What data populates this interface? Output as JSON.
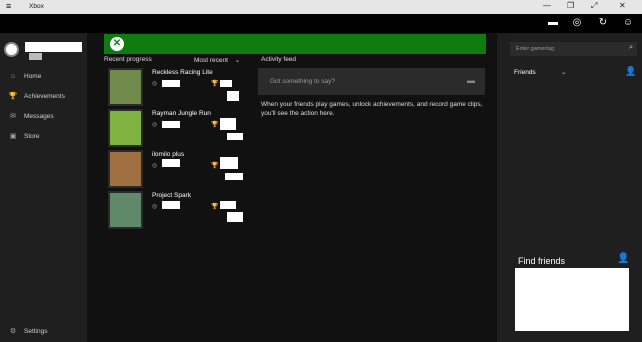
{
  "window": {
    "title": "Xbox"
  },
  "titlebar_icons": {
    "menu": "≡",
    "minimize": "—",
    "restore": "❐",
    "expand": "⤢",
    "close": "✕"
  },
  "toolbar": {
    "messages_icon": "▬",
    "globe_icon": "◎",
    "sync_icon": "↻",
    "smile_icon": "☺"
  },
  "nav": {
    "items": [
      {
        "label": "Home",
        "icon": "⌂"
      },
      {
        "label": "Achievements",
        "icon": "🏆"
      },
      {
        "label": "Messages",
        "icon": "✉"
      },
      {
        "label": "Store",
        "icon": "▣"
      }
    ],
    "settings": {
      "label": "Settings",
      "icon": "⚙"
    }
  },
  "center": {
    "recent_progress_label": "Recent progress",
    "sort_label": "Most recent",
    "sort_chevron": "⌄",
    "games": [
      {
        "title": "Reckless Racing Lite",
        "art_color": "#6f8a4a"
      },
      {
        "title": "Rayman Jungle Run",
        "art_color": "#7fb33f"
      },
      {
        "title": "ilomilo plus",
        "art_color": "#a07040"
      },
      {
        "title": "Project Spark",
        "art_color": "#5f8a6a"
      }
    ],
    "activity_feed_label": "Activity feed",
    "post_placeholder": "Got something to say?",
    "feed_message": "When your friends play games, unlock achievements, and record game clips, you'll see the action here."
  },
  "right": {
    "search_placeholder": "Enter gamertag",
    "friends_label": "Friends",
    "friends_chevron": "⌄",
    "find_friends_label": "Find friends"
  }
}
